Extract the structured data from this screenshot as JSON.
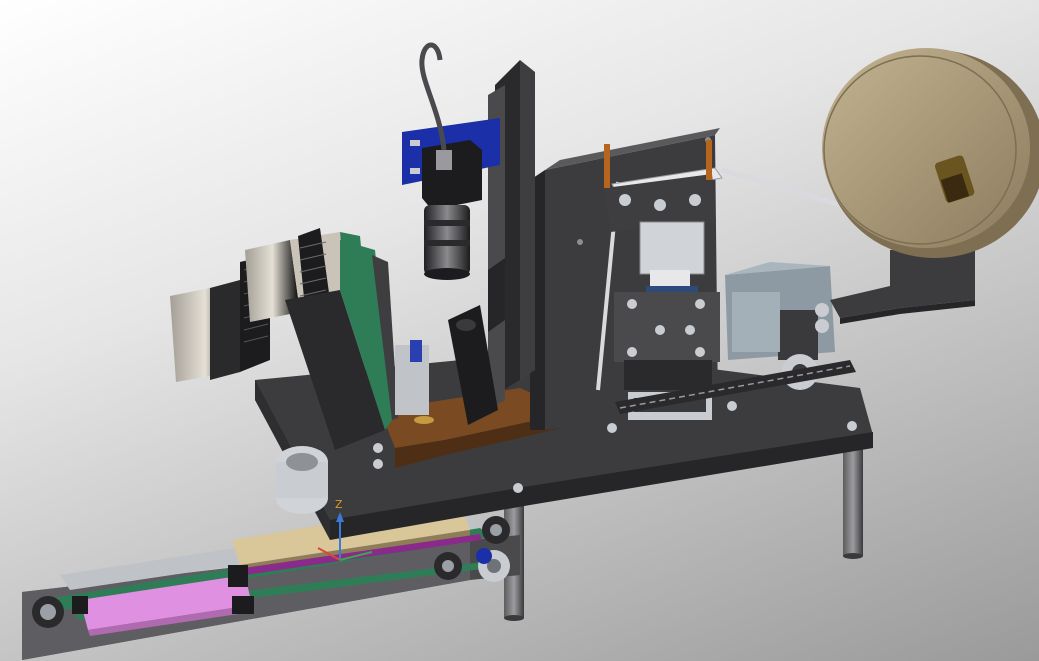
{
  "view": {
    "type": "3d-cad-viewport",
    "background": {
      "top": "#ffffff",
      "bottom": "#9a9a9a"
    }
  },
  "triad": {
    "z_label": "Z",
    "x_label": "",
    "y_label": ""
  },
  "colors": {
    "frame": "#3c3c3e",
    "frame_light": "#5a5a5c",
    "frame_dark": "#262628",
    "motor_body": "#d8d2c8",
    "motor_fins": "#2a2a2a",
    "brown_plate": "#7a4a22",
    "green_part": "#2f7d57",
    "blue_bracket": "#1a2fa8",
    "reel": "#a99878",
    "reel_edge": "#7e6e52",
    "pink_plate": "#e090e0",
    "tan_plate": "#d9c79a",
    "steel": "#c9cdd2",
    "gear_box": "#8d9aa3"
  },
  "parts": [
    "camera-icon",
    "lens-icon",
    "stepper-motor-icon",
    "tape-reel-icon",
    "cylinder-icon",
    "conveyor-icon",
    "pulley-icon",
    "mounting-plate-icon",
    "machine-leg-icon"
  ]
}
